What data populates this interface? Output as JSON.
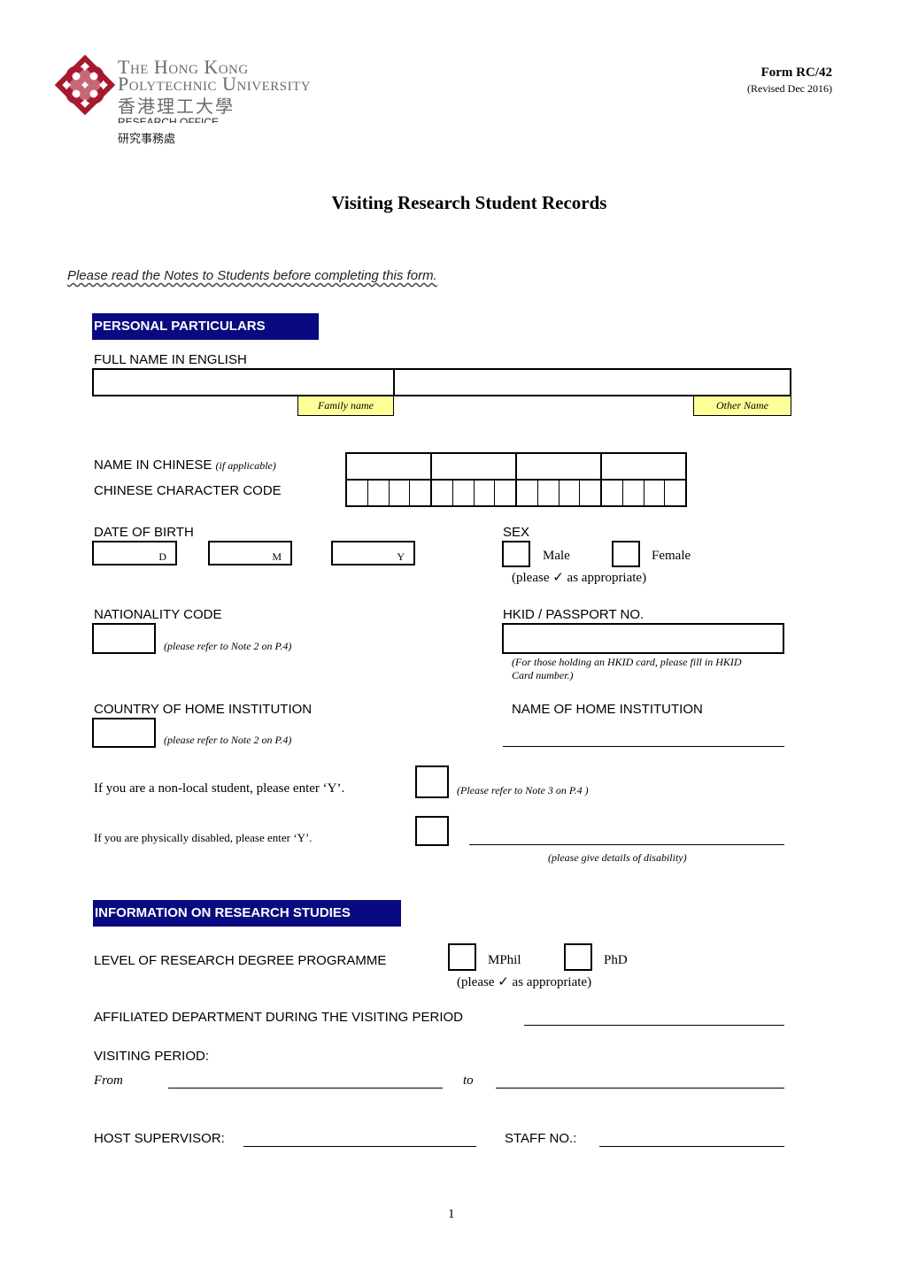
{
  "header": {
    "university_name_line1": "The Hong Kong",
    "university_name_line2": "Polytechnic University",
    "university_name_zh": "香港理工大學",
    "department_en": "RESEARCH OFFICE",
    "department_zh": "研究事務處",
    "form_number": "Form RC/42",
    "revision": "(Revised Dec 2016)",
    "logo_color": "#a6192e"
  },
  "title": "Visiting Research Student Records",
  "instructions": "Please read the Notes to Students before completing this form.",
  "personal": {
    "section_title": "PERSONAL PARTICULARS",
    "full_name_label": "FULL NAME IN ENGLISH",
    "family_name_tag": "Family name",
    "other_name_tag": "Other Name",
    "family_name_value": "",
    "other_name_value": "",
    "chinese_name_label": "NAME IN CHINESE",
    "chinese_name_hint": "(if applicable)",
    "chinese_code_label": "CHINESE CHARACTER CODE",
    "dob_label": "DATE OF BIRTH",
    "dob_day": "D",
    "dob_month": "M",
    "dob_year": "Y",
    "sex_label": "SEX",
    "sex_male": "Male",
    "sex_female": "Female",
    "sex_hint": "(please ✓ as appropriate)",
    "nationality_label": "NATIONALITY CODE",
    "nationality_note": "(please refer to Note 2 on P.4)",
    "hkid_label": "HKID / PASSPORT NO.",
    "hkid_note_line1": "(For those holding an HKID card, please fill in HKID",
    "hkid_note_line2": "Card number.)",
    "country_label": "COUNTRY OF HOME INSTITUTION",
    "country_note": "(please refer to Note 2 on P.4)",
    "institution_label": "NAME OF HOME INSTITUTION",
    "nonlocal_label": "If you are a non-local student, please enter ‘Y’.",
    "nonlocal_note": "(Please refer to Note 3 on P.4 )",
    "disabled_label": "If you are physically disabled, please enter ‘Y’.",
    "disabled_note": "(please give details of disability)"
  },
  "research": {
    "section_title": "INFORMATION ON RESEARCH STUDIES",
    "level_label": "LEVEL OF RESEARCH DEGREE PROGRAMME",
    "option_mphil": "MPhil",
    "option_phd": "PhD",
    "level_hint": "(please ✓ as appropriate)",
    "department_label": "AFFILIATED DEPARTMENT DURING THE VISITING PERIOD",
    "period_label": "VISITING PERIOD:",
    "from_label": "From",
    "to_label": "to",
    "supervisor_label": "HOST SUPERVISOR:",
    "staff_no_label": "STAFF NO.:"
  },
  "footer": {
    "page_number": "1"
  },
  "colors": {
    "section_header_bg": "#0a0a80",
    "tag_bg": "#ffff99"
  }
}
